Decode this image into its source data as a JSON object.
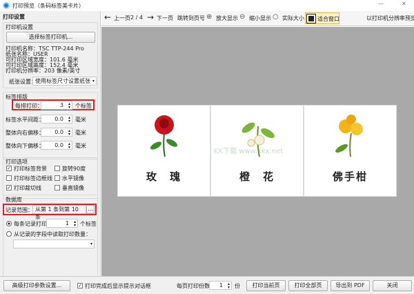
{
  "window": {
    "title": "打印预览（条码标签美卡片）"
  },
  "left": {
    "header": "打印设置",
    "printer_group": {
      "title": "打印机设置",
      "select_button": "选择标签打印机...",
      "info": [
        "打印机名称：TSC TTP-244 Pro",
        "纸张名称：USER",
        "可打印区域宽度：101.6 毫米",
        "可打印区域高度：152.4 毫米",
        "打印机分辨率：203 像素/英寸"
      ],
      "paper_label": "纸张设置：",
      "paper_value": "使用标签尺寸设置纸张"
    },
    "layout_group": {
      "title": "标签排版",
      "rows": [
        {
          "label": "每排打印：",
          "value": "3",
          "unit": "个标签"
        },
        {
          "label": "标签水平间距：",
          "value": "0.0",
          "unit": "毫米"
        },
        {
          "label": "整体向右偏移：",
          "value": "0.0",
          "unit": "毫米"
        },
        {
          "label": "整体向下偏移：",
          "value": "0.0",
          "unit": "毫米"
        }
      ]
    },
    "options_group": {
      "title": "打印选项",
      "checkboxes": [
        {
          "label": "打印标签背景",
          "checked": true
        },
        {
          "label": "旋转90度",
          "checked": false
        },
        {
          "label": "打印标签边框线",
          "checked": false
        },
        {
          "label": "水平镜像",
          "checked": false
        },
        {
          "label": "打印裁切线",
          "checked": true
        },
        {
          "label": "垂直镜像",
          "checked": false
        }
      ]
    },
    "db_group": {
      "title": "数据库",
      "range_label": "记录范围：",
      "range_value": "从第 1 条到第 10 条",
      "range_button": "...",
      "radio1": "每条记录打印",
      "radio1_value": "1",
      "radio1_unit": "个标签",
      "radio2": "从记录的字段中读取打印数量：",
      "field_value": ""
    }
  },
  "toolbar": {
    "prev": "上一页",
    "page": "2 / 4",
    "next": "下一页",
    "goto": "跳转到页号",
    "zoom_in": "放大显示",
    "zoom_out": "缩小显示",
    "actual": "实际大小",
    "fit": "适合窗口",
    "mode": "以打印机分辨率预览"
  },
  "labels": [
    {
      "text": "玫　瑰"
    },
    {
      "text": "橙　花"
    },
    {
      "text": "佛手柑"
    }
  ],
  "watermark": "KK下载 www.kkx.net",
  "bottom": {
    "advanced": "高级打印参数设置...",
    "show_dialog": "打印完成后显示提示对话框",
    "show_dialog_checked": true,
    "copies_label": "每页打印份数：",
    "copies_value": "1",
    "copies_unit": "份",
    "print_current": "打印当前页",
    "print_all": "打印全部页",
    "export_pdf": "导出到 PDF",
    "close": "关闭"
  }
}
